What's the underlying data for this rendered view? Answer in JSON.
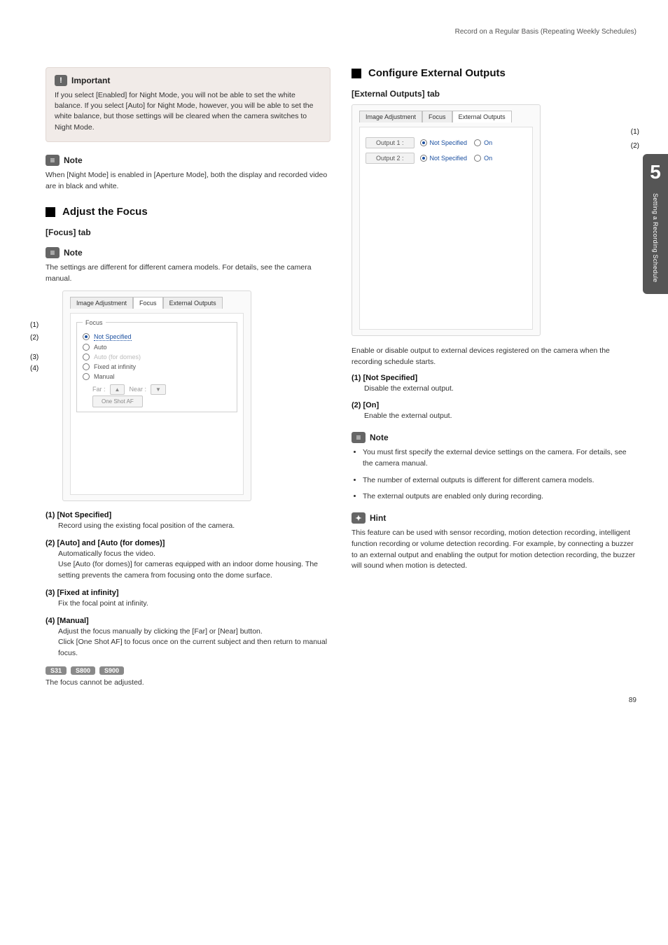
{
  "breadcrumb": "Record on a Regular Basis (Repeating Weekly Schedules)",
  "side": {
    "chapter": "5",
    "label": "Setting a Recording Schedule"
  },
  "left": {
    "important": {
      "title": "Important",
      "body": "If you select [Enabled] for Night Mode, you will not be able to set the white balance. If you select [Auto] for Night Mode, however, you will be able to set the white balance, but those settings will be cleared when the camera switches to Night Mode."
    },
    "note1": {
      "title": "Note",
      "body": "When [Night Mode] is enabled in [Aperture Mode], both the display and recorded video are in black and white."
    },
    "section": "Adjust the Focus",
    "focus_tab": "[Focus] tab",
    "note2": {
      "title": "Note",
      "body": "The settings are different for different camera models. For details, see the camera manual."
    },
    "ui": {
      "tabs": [
        "Image Adjustment",
        "Focus",
        "External Outputs"
      ],
      "legend": "Focus",
      "options": [
        "Not Specified",
        "Auto",
        "Auto (for domes)",
        "Fixed at infinity",
        "Manual"
      ],
      "far": "Far :",
      "near": "Near :",
      "oneshot": "One Shot AF"
    },
    "leaders": [
      "(1)",
      "(2)",
      "(3)",
      "(4)"
    ],
    "items": [
      {
        "hdr": "(1) [Not Specified]",
        "desc": "Record using the existing focal position of the camera."
      },
      {
        "hdr": "(2) [Auto] and [Auto (for domes)]",
        "desc": "Automatically focus the video.\nUse [Auto (for domes)] for cameras equipped with an indoor dome housing. The setting prevents the camera from focusing onto the dome surface."
      },
      {
        "hdr": "(3) [Fixed at infinity]",
        "desc": "Fix the focal point at infinity."
      },
      {
        "hdr": "(4) [Manual]",
        "desc": "Adjust the focus manually by clicking the [Far] or [Near] button.\nClick [One Shot AF] to focus once on the current subject and then return to manual focus."
      }
    ],
    "tags": [
      "S31",
      "S800",
      "S900"
    ],
    "tags_note": "The focus cannot be adjusted."
  },
  "right": {
    "section": "Configure External Outputs",
    "ext_tab": "[External Outputs] tab",
    "ui": {
      "tabs": [
        "Image Adjustment",
        "Focus",
        "External Outputs"
      ],
      "rows": [
        {
          "label": "Output 1 :",
          "o1": "Not Specified",
          "o2": "On"
        },
        {
          "label": "Output 2 :",
          "o1": "Not Specified",
          "o2": "On"
        }
      ]
    },
    "markers": [
      "(1)",
      "(2)"
    ],
    "intro": "Enable or disable output to external devices registered on the camera when the recording schedule starts.",
    "items": [
      {
        "hdr": "(1) [Not Specified]",
        "desc": "Disable the external output."
      },
      {
        "hdr": "(2) [On]",
        "desc": "Enable the external output."
      }
    ],
    "note": {
      "title": "Note",
      "bullets": [
        "You must first specify the external device settings on the camera. For details, see the camera manual.",
        "The number of external outputs is different for different camera models.",
        "The external outputs are enabled only during recording."
      ]
    },
    "hint": {
      "title": "Hint",
      "body": "This feature can be used with sensor recording, motion detection recording, intelligent function recording or volume detection recording. For example, by connecting a buzzer to an external output and enabling the output for motion detection recording, the buzzer will sound when motion is detected."
    }
  },
  "page": "89"
}
